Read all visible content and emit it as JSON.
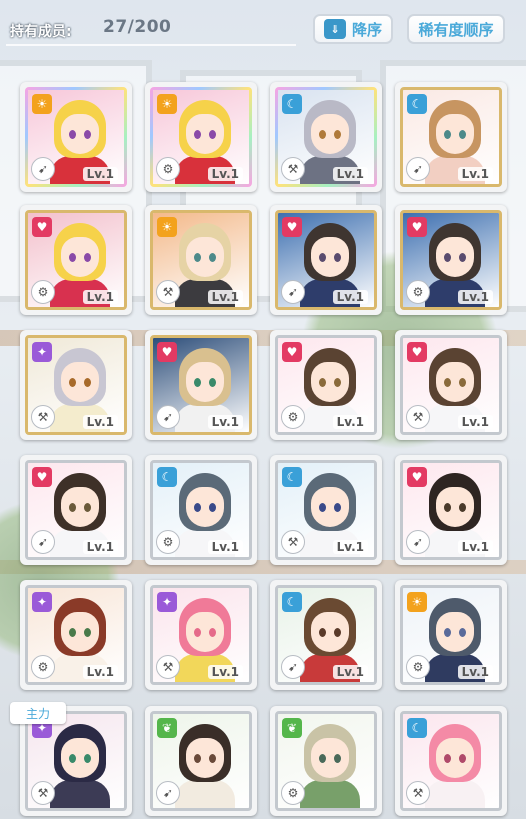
{
  "header": {
    "owned_label": "持有成员:",
    "owned_count": "27/200",
    "sort_order_label": "降序",
    "sort_order_icon": "double-chevron-down-icon",
    "sort_key_label": "稀有度顺序"
  },
  "main_tag": "主力",
  "attribute_colors": {
    "sun": "#f3a21d",
    "moon": "#3aa0d8",
    "heart": "#e33a63",
    "star": "#9a5ad8",
    "leaf": "#55b64b"
  },
  "cards": [
    {
      "lv": "Lv.1",
      "attr": "sun",
      "frame": "rainbow",
      "hair": "#f6d24a",
      "bg": "#f7c7d9",
      "outfit": "#d8313b",
      "eye": "#8a4aa8"
    },
    {
      "lv": "Lv.1",
      "attr": "sun",
      "frame": "rainbow",
      "hair": "#f6d24a",
      "bg": "#f7c7d9",
      "outfit": "#d8313b",
      "eye": "#8a4aa8"
    },
    {
      "lv": "Lv.1",
      "attr": "moon",
      "frame": "rainbow",
      "hair": "#b9b9c6",
      "bg": "#d9e3f0",
      "outfit": "#6d7283",
      "eye": "#b07a3a"
    },
    {
      "lv": "Lv.1",
      "attr": "moon",
      "frame": "gold",
      "hair": "#c79561",
      "bg": "#fae9e4",
      "outfit": "#f2cfc2",
      "eye": "#4d8a8a"
    },
    {
      "lv": "Lv.1",
      "attr": "heart",
      "frame": "gold",
      "hair": "#f6d24a",
      "bg": "#f3c0cc",
      "outfit": "#d8314f",
      "eye": "#8a4aa8"
    },
    {
      "lv": "Lv.1",
      "attr": "sun",
      "frame": "gold",
      "hair": "#e6d3a5",
      "bg": "#f3b98a",
      "outfit": "#3c3b3f",
      "eye": "#4d8a8a"
    },
    {
      "lv": "Lv.1",
      "attr": "heart",
      "frame": "gold",
      "hair": "#3f3530",
      "bg": "#3d6fb0",
      "outfit": "#2e3d6b",
      "eye": "#5a4b6e"
    },
    {
      "lv": "Lv.1",
      "attr": "heart",
      "frame": "gold",
      "hair": "#3f3530",
      "bg": "#3d6fb0",
      "outfit": "#2e3d6b",
      "eye": "#5a4b6e"
    },
    {
      "lv": "Lv.1",
      "attr": "star",
      "frame": "gold",
      "hair": "#c8c6d2",
      "bg": "#f0e9d8",
      "outfit": "#f4eccd",
      "eye": "#a86a2a"
    },
    {
      "lv": "Lv.1",
      "attr": "heart",
      "frame": "gold",
      "hair": "#d9c08f",
      "bg": "#2d4e7a",
      "outfit": "#f1f1f1",
      "eye": "#3a8a6a"
    },
    {
      "lv": "Lv.1",
      "attr": "heart",
      "frame": "silver",
      "hair": "#5a4332",
      "bg": "#fde7ee",
      "outfit": "#f6f6f8",
      "eye": "#8a6a3a"
    },
    {
      "lv": "Lv.1",
      "attr": "heart",
      "frame": "silver",
      "hair": "#5a4332",
      "bg": "#fde7ee",
      "outfit": "#f6f6f8",
      "eye": "#8a6a3a"
    },
    {
      "lv": "Lv.1",
      "attr": "heart",
      "frame": "silver",
      "hair": "#3e3028",
      "bg": "#fde7ee",
      "outfit": "#f6f6f8",
      "eye": "#6a5a3a"
    },
    {
      "lv": "Lv.1",
      "attr": "moon",
      "frame": "silver",
      "hair": "#5b6a78",
      "bg": "#e3f0f8",
      "outfit": "#f6f6f8",
      "eye": "#3a4a8a"
    },
    {
      "lv": "Lv.1",
      "attr": "moon",
      "frame": "silver",
      "hair": "#5b6a78",
      "bg": "#e3f0f8",
      "outfit": "#f6f6f8",
      "eye": "#3a4a8a"
    },
    {
      "lv": "Lv.1",
      "attr": "heart",
      "frame": "silver",
      "hair": "#2e2522",
      "bg": "#fde7ee",
      "outfit": "#f6f6f8",
      "eye": "#4a3a2a"
    },
    {
      "lv": "Lv.1",
      "attr": "star",
      "frame": "silver",
      "hair": "#8a3a28",
      "bg": "#f8e6d8",
      "outfit": "#f9f1e8",
      "eye": "#4a7a4a"
    },
    {
      "lv": "Lv.1",
      "attr": "star",
      "frame": "silver",
      "hair": "#f07a98",
      "bg": "#fbe4ec",
      "outfit": "#f2d75a",
      "eye": "#e56a8a"
    },
    {
      "lv": "Lv.1",
      "attr": "moon",
      "frame": "silver",
      "hair": "#6a4a32",
      "bg": "#e8f2e8",
      "outfit": "#c83a3a",
      "eye": "#5a3a2a"
    },
    {
      "lv": "Lv.1",
      "attr": "sun",
      "frame": "silver",
      "hair": "#4e5a6b",
      "bg": "#eef3f8",
      "outfit": "#2f3b60",
      "eye": "#5a6a9a"
    },
    {
      "lv": "",
      "attr": "star",
      "frame": "silver",
      "hair": "#2b2a45",
      "bg": "#f5e6ee",
      "outfit": "#3c3b55",
      "eye": "#3a8a6a"
    },
    {
      "lv": "",
      "attr": "leaf",
      "frame": "silver",
      "hair": "#3a2e28",
      "bg": "#eef5ea",
      "outfit": "#f2ebe0",
      "eye": "#6a4a3a"
    },
    {
      "lv": "",
      "attr": "leaf",
      "frame": "silver",
      "hair": "#c9c3a6",
      "bg": "#f2f6ee",
      "outfit": "#78a06a",
      "eye": "#4a6a5a"
    },
    {
      "lv": "",
      "attr": "moon",
      "frame": "silver",
      "hair": "#f48aa6",
      "bg": "#fbe6ee",
      "outfit": "#f8f1f3",
      "eye": "#b04a6a"
    }
  ]
}
